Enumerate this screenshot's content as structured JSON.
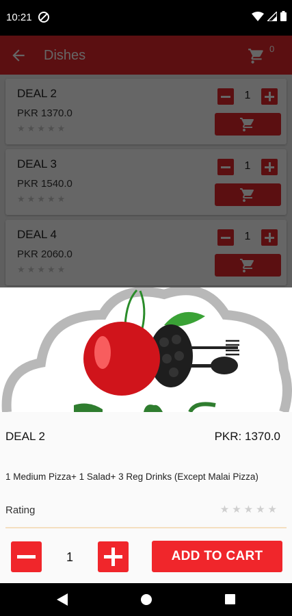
{
  "status_bar": {
    "time": "10:21"
  },
  "toolbar": {
    "title": "Dishes",
    "cart_count": "0"
  },
  "dishes": [
    {
      "name": "DEAL 2",
      "price": "PKR 1370.0",
      "qty": "1"
    },
    {
      "name": "DEAL 3",
      "price": "PKR 1540.0",
      "qty": "1"
    },
    {
      "name": "DEAL 4",
      "price": "PKR 2060.0",
      "qty": "1"
    }
  ],
  "detail": {
    "title": "DEAL 2",
    "price": "PKR: 1370.0",
    "description": "1 Medium Pizza+ 1 Salad+ 3 Reg Drinks (Except Malai Pizza)",
    "rating_label": "Rating",
    "rating_value": 0,
    "qty": "1",
    "add_to_cart_label": "ADD TO CART"
  },
  "colors": {
    "accent": "#e4262b",
    "toolbar": "#e4262b"
  },
  "icons": [
    "back-arrow-icon",
    "cart-icon",
    "star-icon",
    "minus-icon",
    "plus-icon"
  ]
}
